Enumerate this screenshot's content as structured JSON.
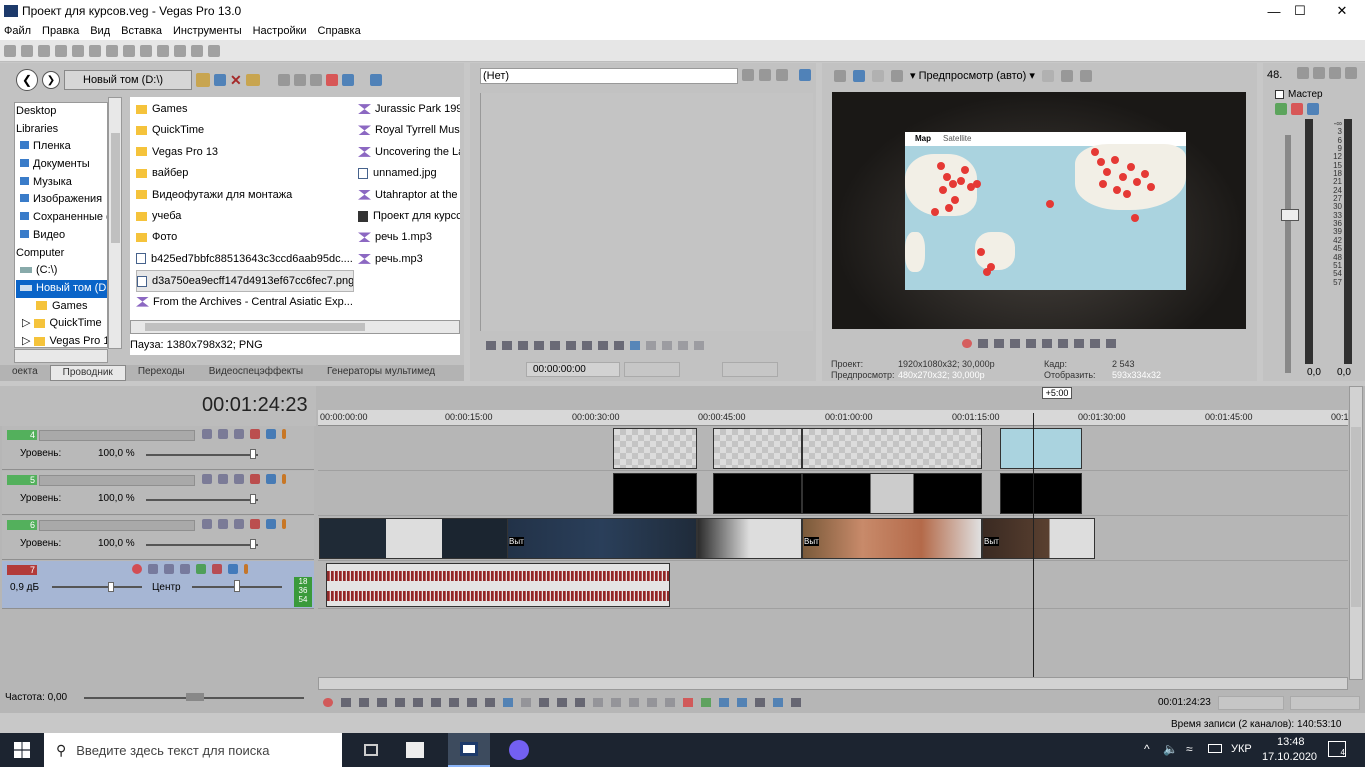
{
  "window": {
    "title": "Проект для курсов.veg - Vegas Pro 13.0",
    "minimize": "—",
    "maximize": "☐",
    "close": "✕"
  },
  "menu": [
    "Файл",
    "Правка",
    "Вид",
    "Вставка",
    "Инструменты",
    "Настройки",
    "Справка"
  ],
  "explorer": {
    "path": "Новый том (D:\\)",
    "tree": [
      "Desktop",
      "Libraries",
      "Пленка",
      "Документы",
      "Музыка",
      "Изображения",
      "Сохраненные ф",
      "Видео",
      "Computer",
      "(C:\\)",
      "Новый том (D:\\)",
      "Games",
      "QuickTime",
      "Vegas Pro 13"
    ],
    "files_col1": [
      "Games",
      "QuickTime",
      "Vegas Pro 13",
      "вайбер",
      "Видеофутажи для монтажа",
      "учеба",
      "Фото",
      "b425ed7bbfc88513643c3ccd6aab95dc....",
      "d3a750ea9ecff147d4913ef67cc6fec7.png",
      "From the Archives - Central Asiatic Exp..."
    ],
    "files_col2": [
      "Jurassic Park 1993",
      "Royal Tyrrell Muse",
      "Uncovering the La",
      "unnamed.jpg",
      "Utahraptor at the",
      "Проект для курсс",
      "речь 1.mp3",
      "речь.mp3"
    ],
    "status": "Пауза: 1380x798x32; PNG",
    "tabs": [
      "оекта",
      "Проводник",
      "Переходы",
      "Видеоспецэффекты",
      "Генераторы мультимед"
    ]
  },
  "trimmer": {
    "dropdown": "(Нет)",
    "time": "00:00:00:00"
  },
  "preview": {
    "mode": "Предпросмотр (авто)",
    "map_tab1": "Map",
    "map_tab2": "Satellite",
    "info": {
      "project_label": "Проект:",
      "project_value": "1920x1080x32; 30,000p",
      "preview_label": "Предпросмотр:",
      "preview_value": "480x270x32; 30,000p",
      "frame_label": "Кадр:",
      "frame_value": "2 543",
      "display_label": "Отобразить:",
      "display_value": "593x334x32"
    }
  },
  "master": {
    "label": "Мастер",
    "top": "48.",
    "scale": [
      "3",
      "6",
      "9",
      "12",
      "15",
      "18",
      "21",
      "24",
      "27",
      "30",
      "33",
      "36",
      "39",
      "42",
      "45",
      "48",
      "51",
      "54",
      "57"
    ],
    "left": "0,0",
    "right": "0,0",
    "inf": "-∞"
  },
  "timeline": {
    "timecode": "00:01:24:23",
    "badge": "+5:00",
    "ruler": [
      "00:00:00:00",
      "00:00:15:00",
      "00:00:30:00",
      "00:00:45:00",
      "00:01:00:00",
      "00:01:15:00",
      "00:01:30:00",
      "00:01:45:00",
      "00:1"
    ],
    "tracks": [
      {
        "num": "4",
        "level_label": "Уровень:",
        "level": "100,0 %"
      },
      {
        "num": "5",
        "level_label": "Уровень:",
        "level": "100,0 %"
      },
      {
        "num": "6",
        "level_label": "Уровень:",
        "level": "100,0 %"
      }
    ],
    "audio": {
      "num": "7",
      "db": "0,9 дБ",
      "pan": "Центр",
      "meter": [
        "18",
        "36",
        "54"
      ]
    },
    "clip_labels": [
      "Выт",
      "Выт",
      "Выт"
    ],
    "rate": "Частота: 0,00",
    "end_time": "00:01:24:23",
    "record": "Время записи (2 каналов): 140:53:10"
  },
  "taskbar": {
    "search": "Введите здесь текст для поиска",
    "lang": "УКР",
    "time": "13:48",
    "date": "17.10.2020",
    "notif": "4"
  }
}
